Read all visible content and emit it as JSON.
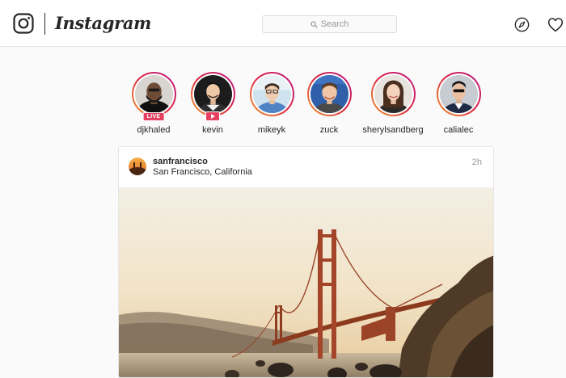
{
  "header": {
    "brand": "Instagram",
    "search_placeholder": "Search"
  },
  "stories": [
    {
      "username": "djkhaled",
      "badge": "LIVE"
    },
    {
      "username": "kevin",
      "badge": "play-icon"
    },
    {
      "username": "mikeyk"
    },
    {
      "username": "zuck"
    },
    {
      "username": "sherylsandberg"
    },
    {
      "username": "calialec"
    }
  ],
  "post": {
    "username": "sanfrancisco",
    "location": "San Francisco, California",
    "time": "2h"
  },
  "icons": [
    "instagram-camera-icon",
    "search-icon",
    "explore-compass-icon",
    "heart-icon",
    "play-icon"
  ],
  "colors": {
    "story_ring_gradient": [
      "#f09433",
      "#e6683c",
      "#dc2743",
      "#cc2366",
      "#bc1888"
    ],
    "live_badge": "#e4405f",
    "text": "#262626",
    "muted": "#999999",
    "border": "#e6e6e6",
    "background": "#fafafa"
  }
}
